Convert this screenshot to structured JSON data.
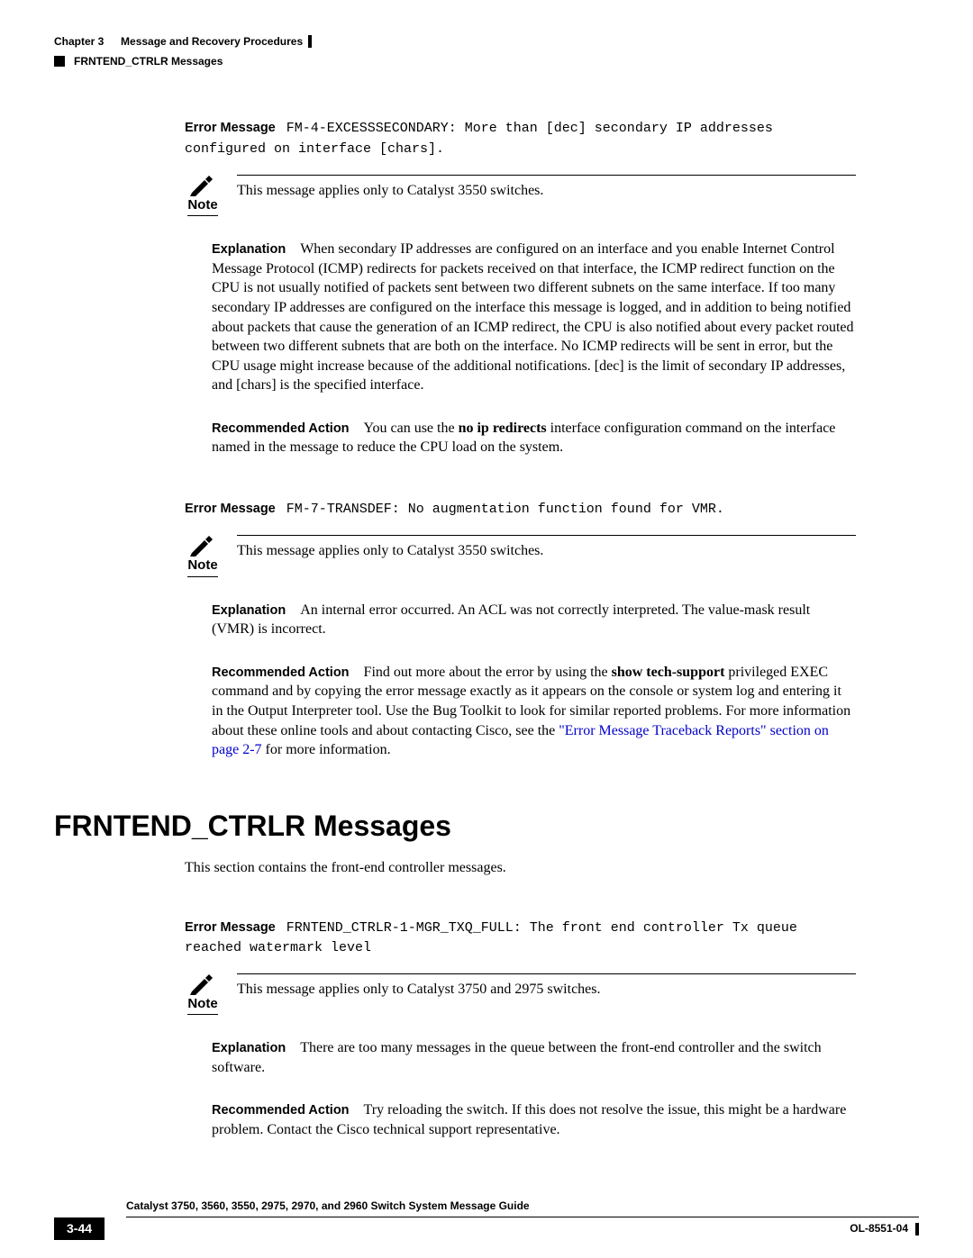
{
  "header": {
    "section_name": "FRNTEND_CTRLR Messages",
    "chapter": "Chapter 3",
    "chapter_title": "Message and Recovery Procedures"
  },
  "messages": [
    {
      "error_label": "Error Message",
      "error_text": "FM-4-EXCESSSECONDARY: More than [dec] secondary IP addresses configured on interface [chars].",
      "note_label": "Note",
      "note_text": "This message applies only to Catalyst 3550 switches.",
      "explanation_label": "Explanation",
      "explanation_text": "When secondary IP addresses are configured on an interface and you enable Internet Control Message Protocol (ICMP) redirects for packets received on that interface, the ICMP redirect function on the CPU is not usually notified of packets sent between two different subnets on the same interface. If too many secondary IP addresses are configured on the interface this message is logged, and in addition to being notified about packets that cause the generation of an ICMP redirect, the CPU is also notified about every packet routed between two different subnets that are both on the interface. No ICMP redirects will be sent in error, but the CPU usage might increase because of the additional notifications. [dec] is the limit of secondary IP addresses, and [chars] is the specified interface.",
      "action_label": "Recommended Action",
      "action_pre": "You can use the ",
      "action_cmd": "no ip redirects",
      "action_post": " interface configuration command on the interface named in the message to reduce the CPU load on the system."
    },
    {
      "error_label": "Error Message",
      "error_text": "FM-7-TRANSDEF: No augmentation function found for VMR.",
      "note_label": "Note",
      "note_text": "This message applies only to Catalyst 3550 switches.",
      "explanation_label": "Explanation",
      "explanation_text": "An internal error occurred. An ACL was not correctly interpreted. The value-mask result (VMR) is incorrect.",
      "action_label": "Recommended Action",
      "action_pre": "Find out more about the error by using the ",
      "action_cmd": "show tech-support",
      "action_post": " privileged EXEC command and by copying the error message exactly as it appears on the console or system log and entering it in the Output Interpreter tool. Use the Bug Toolkit to look for similar reported problems. For more information about these online tools and about contacting Cisco, see the ",
      "action_link": "\"Error Message Traceback Reports\" section on page 2-7",
      "action_tail": " for more information."
    }
  ],
  "section": {
    "heading": "FRNTEND_CTRLR Messages",
    "intro": "This section contains the front-end controller messages."
  },
  "message3": {
    "error_label": "Error Message",
    "error_text": "FRNTEND_CTRLR-1-MGR_TXQ_FULL: The front end controller Tx queue reached watermark level",
    "note_label": "Note",
    "note_text": "This message applies only to Catalyst 3750 and 2975 switches.",
    "explanation_label": "Explanation",
    "explanation_text": "There are too many messages in the queue between the front-end controller and the switch software.",
    "action_label": "Recommended Action",
    "action_text": "Try reloading the switch. If this does not resolve the issue, this might be a hardware problem. Contact the Cisco technical support representative."
  },
  "footer": {
    "guide_title": "Catalyst 3750, 3560, 3550, 2975, 2970, and 2960 Switch System Message Guide",
    "page_num": "3-44",
    "doc_id": "OL-8551-04"
  }
}
